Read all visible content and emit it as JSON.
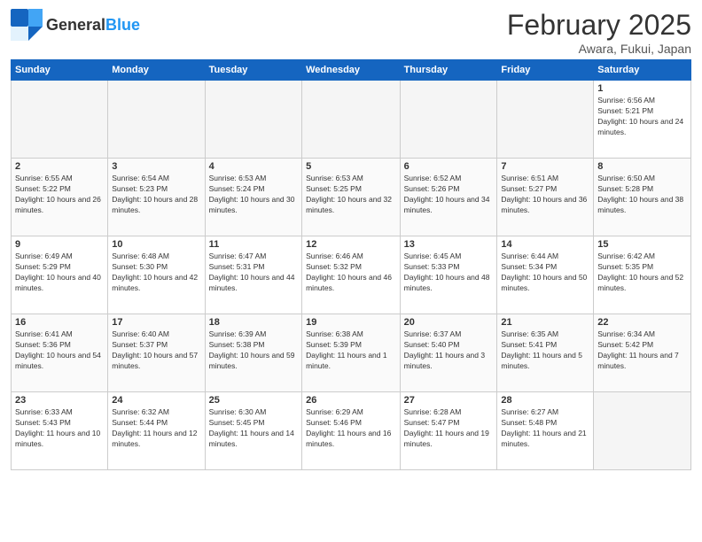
{
  "header": {
    "logo_general": "General",
    "logo_blue": "Blue",
    "title": "February 2025",
    "subtitle": "Awara, Fukui, Japan"
  },
  "weekdays": [
    "Sunday",
    "Monday",
    "Tuesday",
    "Wednesday",
    "Thursday",
    "Friday",
    "Saturday"
  ],
  "weeks": [
    [
      {
        "day": "",
        "info": ""
      },
      {
        "day": "",
        "info": ""
      },
      {
        "day": "",
        "info": ""
      },
      {
        "day": "",
        "info": ""
      },
      {
        "day": "",
        "info": ""
      },
      {
        "day": "",
        "info": ""
      },
      {
        "day": "1",
        "info": "Sunrise: 6:56 AM\nSunset: 5:21 PM\nDaylight: 10 hours and 24 minutes."
      }
    ],
    [
      {
        "day": "2",
        "info": "Sunrise: 6:55 AM\nSunset: 5:22 PM\nDaylight: 10 hours and 26 minutes."
      },
      {
        "day": "3",
        "info": "Sunrise: 6:54 AM\nSunset: 5:23 PM\nDaylight: 10 hours and 28 minutes."
      },
      {
        "day": "4",
        "info": "Sunrise: 6:53 AM\nSunset: 5:24 PM\nDaylight: 10 hours and 30 minutes."
      },
      {
        "day": "5",
        "info": "Sunrise: 6:53 AM\nSunset: 5:25 PM\nDaylight: 10 hours and 32 minutes."
      },
      {
        "day": "6",
        "info": "Sunrise: 6:52 AM\nSunset: 5:26 PM\nDaylight: 10 hours and 34 minutes."
      },
      {
        "day": "7",
        "info": "Sunrise: 6:51 AM\nSunset: 5:27 PM\nDaylight: 10 hours and 36 minutes."
      },
      {
        "day": "8",
        "info": "Sunrise: 6:50 AM\nSunset: 5:28 PM\nDaylight: 10 hours and 38 minutes."
      }
    ],
    [
      {
        "day": "9",
        "info": "Sunrise: 6:49 AM\nSunset: 5:29 PM\nDaylight: 10 hours and 40 minutes."
      },
      {
        "day": "10",
        "info": "Sunrise: 6:48 AM\nSunset: 5:30 PM\nDaylight: 10 hours and 42 minutes."
      },
      {
        "day": "11",
        "info": "Sunrise: 6:47 AM\nSunset: 5:31 PM\nDaylight: 10 hours and 44 minutes."
      },
      {
        "day": "12",
        "info": "Sunrise: 6:46 AM\nSunset: 5:32 PM\nDaylight: 10 hours and 46 minutes."
      },
      {
        "day": "13",
        "info": "Sunrise: 6:45 AM\nSunset: 5:33 PM\nDaylight: 10 hours and 48 minutes."
      },
      {
        "day": "14",
        "info": "Sunrise: 6:44 AM\nSunset: 5:34 PM\nDaylight: 10 hours and 50 minutes."
      },
      {
        "day": "15",
        "info": "Sunrise: 6:42 AM\nSunset: 5:35 PM\nDaylight: 10 hours and 52 minutes."
      }
    ],
    [
      {
        "day": "16",
        "info": "Sunrise: 6:41 AM\nSunset: 5:36 PM\nDaylight: 10 hours and 54 minutes."
      },
      {
        "day": "17",
        "info": "Sunrise: 6:40 AM\nSunset: 5:37 PM\nDaylight: 10 hours and 57 minutes."
      },
      {
        "day": "18",
        "info": "Sunrise: 6:39 AM\nSunset: 5:38 PM\nDaylight: 10 hours and 59 minutes."
      },
      {
        "day": "19",
        "info": "Sunrise: 6:38 AM\nSunset: 5:39 PM\nDaylight: 11 hours and 1 minute."
      },
      {
        "day": "20",
        "info": "Sunrise: 6:37 AM\nSunset: 5:40 PM\nDaylight: 11 hours and 3 minutes."
      },
      {
        "day": "21",
        "info": "Sunrise: 6:35 AM\nSunset: 5:41 PM\nDaylight: 11 hours and 5 minutes."
      },
      {
        "day": "22",
        "info": "Sunrise: 6:34 AM\nSunset: 5:42 PM\nDaylight: 11 hours and 7 minutes."
      }
    ],
    [
      {
        "day": "23",
        "info": "Sunrise: 6:33 AM\nSunset: 5:43 PM\nDaylight: 11 hours and 10 minutes."
      },
      {
        "day": "24",
        "info": "Sunrise: 6:32 AM\nSunset: 5:44 PM\nDaylight: 11 hours and 12 minutes."
      },
      {
        "day": "25",
        "info": "Sunrise: 6:30 AM\nSunset: 5:45 PM\nDaylight: 11 hours and 14 minutes."
      },
      {
        "day": "26",
        "info": "Sunrise: 6:29 AM\nSunset: 5:46 PM\nDaylight: 11 hours and 16 minutes."
      },
      {
        "day": "27",
        "info": "Sunrise: 6:28 AM\nSunset: 5:47 PM\nDaylight: 11 hours and 19 minutes."
      },
      {
        "day": "28",
        "info": "Sunrise: 6:27 AM\nSunset: 5:48 PM\nDaylight: 11 hours and 21 minutes."
      },
      {
        "day": "",
        "info": ""
      }
    ]
  ]
}
